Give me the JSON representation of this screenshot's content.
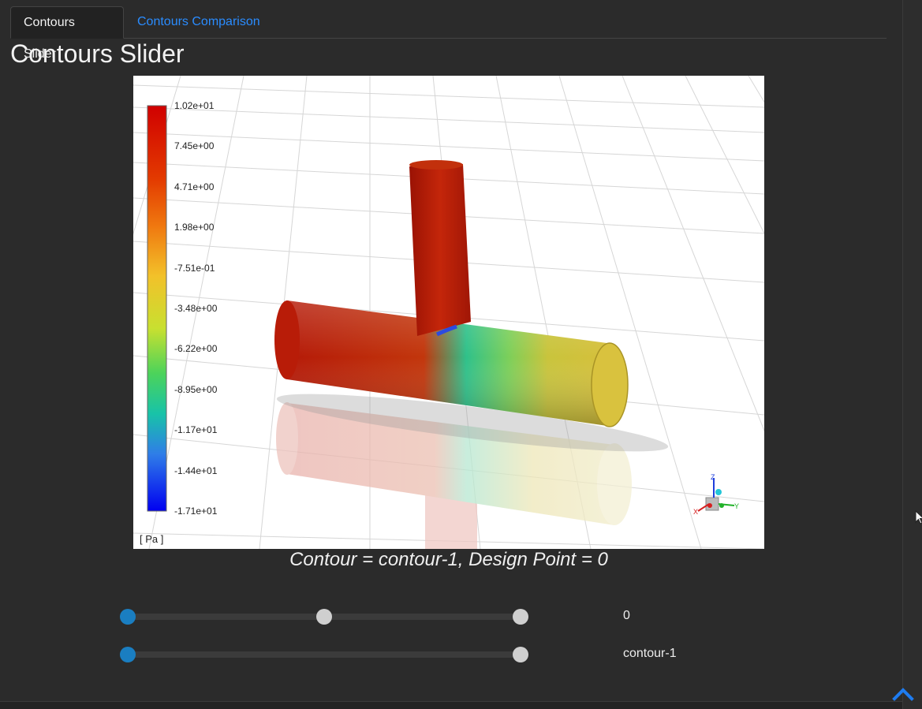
{
  "tabs": [
    {
      "label": "Contours Slider",
      "active": true
    },
    {
      "label": "Contours Comparison",
      "active": false
    }
  ],
  "page_title": "Contours Slider",
  "plot": {
    "colorbar_labels": [
      "1.02e+01",
      "7.45e+00",
      "4.71e+00",
      "1.98e+00",
      "-7.51e-01",
      "-3.48e+00",
      "-6.22e+00",
      "-8.95e+00",
      "-1.17e+01",
      "-1.44e+01",
      "-1.71e+01"
    ],
    "unit_label": "[ Pa ]",
    "axis_triad": {
      "x": "X",
      "y": "Y",
      "z": "Z"
    }
  },
  "caption": "Contour = contour-1, Design Point = 0",
  "sliders": [
    {
      "name": "design-point",
      "value_text": "0",
      "position": 0.0,
      "ticks": 3
    },
    {
      "name": "contour",
      "value_text": "contour-1",
      "position": 0.0,
      "ticks": 2
    }
  ],
  "colors": {
    "background": "#2b2b2b",
    "tab_link": "#2a8cff",
    "slider_active": "#1a7ec1",
    "slider_mark": "#cfcfcf"
  },
  "icons": {
    "scroll_top": "chevron-up-icon",
    "cursor": "mouse-pointer-icon"
  }
}
